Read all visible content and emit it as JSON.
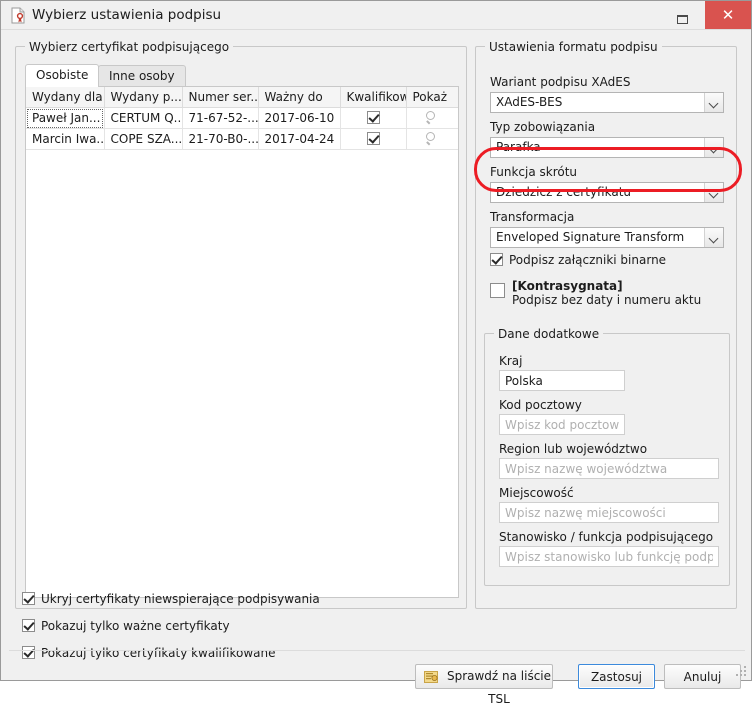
{
  "window": {
    "title": "Wybierz ustawienia podpisu",
    "title_icon": "signed-document-icon",
    "minimize_label": "",
    "close_label": "✕",
    "close_color": "#d9534f"
  },
  "left_panel": {
    "group_title": "Wybierz certyfikat podpisującego",
    "tabs": [
      {
        "label": "Osobiste",
        "active": true
      },
      {
        "label": "Inne osoby",
        "active": false
      }
    ],
    "table": {
      "columns": [
        "Wydany dla",
        "Wydany p...",
        "Numer ser...",
        "Ważny do",
        "Kwalifikow...",
        "Pokaż"
      ],
      "rows": [
        {
          "wydany_dla": "Paweł Jan...",
          "wydany_przez": "CERTUM Q...",
          "numer_seryjny": "71-67-52-...",
          "wazny_do": "2017-06-10",
          "kwalifikowany": true,
          "pokaz": "search-icon"
        },
        {
          "wydany_dla": "Marcin Iwa...",
          "wydany_przez": "COPE SZA...",
          "numer_seryjny": "21-70-B0-...",
          "wazny_do": "2017-04-24",
          "kwalifikowany": true,
          "pokaz": "search-icon"
        }
      ]
    }
  },
  "right_panel": {
    "group_title": "Ustawienia formatu podpisu",
    "xades_label": "Wariant podpisu XAdES",
    "xades_value": "XAdES-BES",
    "commitment_label": "Typ zobowiązania",
    "commitment_value": "Parafka",
    "hash_label": "Funkcja skrótu",
    "hash_value": "Dziedzicz z certyfikatu",
    "transform_label": "Transformacja",
    "transform_value": "Enveloped Signature Transform",
    "binary_attachments_label": "Podpisz załączniki binarne",
    "binary_attachments_checked": true,
    "countersign_title": "[Kontrasygnata]",
    "countersign_subtitle": "Podpisz bez daty i numeru aktu",
    "countersign_checked": false,
    "highlight_color": "#ec1c24"
  },
  "extra_data": {
    "group_title": "Dane dodatkowe",
    "fields": [
      {
        "label": "Kraj",
        "value": "Polska",
        "placeholder": ""
      },
      {
        "label": "Kod pocztowy",
        "value": "",
        "placeholder": "Wpisz kod pocztowy"
      },
      {
        "label": "Region lub województwo",
        "value": "",
        "placeholder": "Wpisz nazwę województwa"
      },
      {
        "label": "Miejscowość",
        "value": "",
        "placeholder": "Wpisz nazwę miejscowości"
      },
      {
        "label": "Stanowisko / funkcja podpisującego",
        "value": "",
        "placeholder": "Wpisz stanowisko lub funkcję podpisującego"
      }
    ]
  },
  "bottom_options": [
    {
      "label": "Ukryj certyfikaty niewspierające podpisywania",
      "checked": true
    },
    {
      "label": "Pokazuj tylko ważne certyfikaty",
      "checked": true
    },
    {
      "label": "Pokazuj tylko certyfikaty kwalifikowane",
      "checked": true
    }
  ],
  "buttons": {
    "tsl": "Sprawdź na liście TSL",
    "tsl_icon": "certificate-list-icon",
    "apply": "Zastosuj",
    "cancel": "Anuluj"
  }
}
